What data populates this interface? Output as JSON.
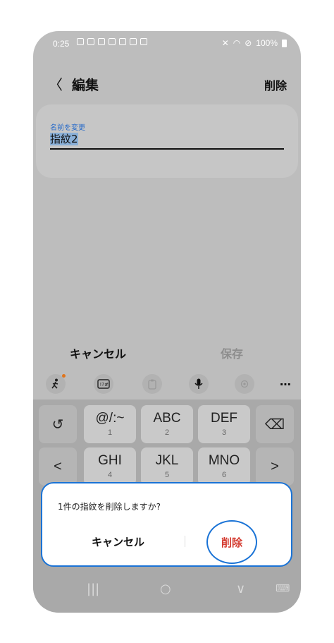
{
  "status_bar": {
    "time": "0:25",
    "battery": "100%",
    "notification_icons": [
      "chat-icon",
      "download-icon",
      "app-icon",
      "mail-icon",
      "image-icon",
      "calendar-icon",
      "card-icon"
    ],
    "system_icons": [
      "mute-icon",
      "wifi-icon",
      "block-icon",
      "battery-icon"
    ]
  },
  "header": {
    "back_label": "〈",
    "title": "編集",
    "delete_label": "削除"
  },
  "name_field": {
    "label": "名前を変更",
    "value": "指紋2"
  },
  "actions": {
    "cancel_label": "キャンセル",
    "save_label": "保存"
  },
  "keyboard_toolbar": [
    "stickman-icon",
    "symbols-icon",
    "clipboard-icon",
    "mic-icon",
    "settings-icon",
    "more-icon"
  ],
  "keyboard": {
    "rows": [
      [
        {
          "main": "↺",
          "sub": ""
        },
        {
          "main": "@/:~",
          "sub": "1"
        },
        {
          "main": "ABC",
          "sub": "2"
        },
        {
          "main": "DEF",
          "sub": "3"
        },
        {
          "main": "⌫",
          "sub": ""
        }
      ],
      [
        {
          "main": "<",
          "sub": ""
        },
        {
          "main": "GHI",
          "sub": "4"
        },
        {
          "main": "JKL",
          "sub": "5"
        },
        {
          "main": "MNO",
          "sub": "6"
        },
        {
          "main": ">",
          "sub": ""
        }
      ]
    ]
  },
  "dialog": {
    "message": "1件の指紋を削除しますか?",
    "cancel_label": "キャンセル",
    "delete_label": "削除",
    "accent": "#1a73d6",
    "delete_color": "#d43a2f"
  },
  "nav_bar": {
    "recents": "|||",
    "home": "○",
    "back": "∨",
    "keyboard": "⌨"
  }
}
